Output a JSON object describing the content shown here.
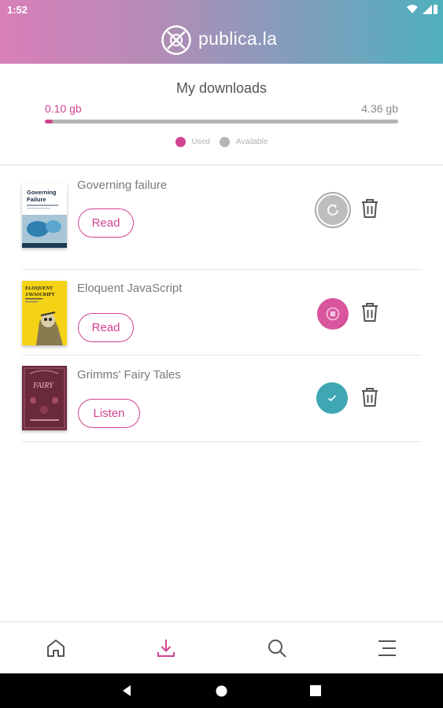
{
  "status_bar": {
    "time": "1:52"
  },
  "header": {
    "brand": "publica.la"
  },
  "storage": {
    "title": "My downloads",
    "used": "0.10 gb",
    "total": "4.36 gb",
    "used_fraction": 0.0229,
    "legend_used": "Used",
    "legend_available": "Available"
  },
  "books": [
    {
      "title": "Governing failure",
      "action": "Read",
      "status": "queued",
      "cover": "governing-failure-cover",
      "cover_text": [
        "Governing",
        "Failure"
      ]
    },
    {
      "title": "Eloquent JavaScript",
      "action": "Read",
      "status": "downloading",
      "cover": "eloquent-javascript-cover",
      "cover_text": [
        "ELOQUENT",
        "JAVASCRIPT"
      ]
    },
    {
      "title": "Grimms' Fairy Tales",
      "action": "Listen",
      "status": "downloaded",
      "cover": "grimms-fairy-tales-cover",
      "cover_text": [
        "FAIRY"
      ]
    }
  ],
  "colors": {
    "accent": "#d0438f",
    "teal": "#3ea7b3",
    "gray": "#b5b5b5"
  },
  "nav": [
    "home-icon",
    "download-icon",
    "search-icon",
    "menu-icon"
  ]
}
